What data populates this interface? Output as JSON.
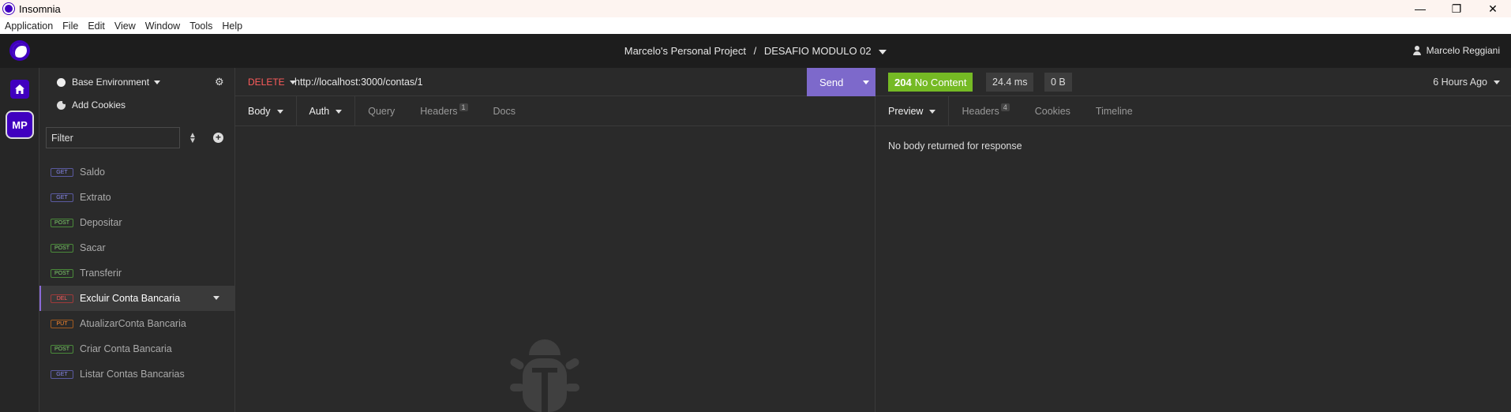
{
  "window": {
    "title": "Insomnia",
    "controls": [
      "minimize",
      "restore",
      "close"
    ]
  },
  "menu": [
    "Application",
    "File",
    "Edit",
    "View",
    "Window",
    "Tools",
    "Help"
  ],
  "header": {
    "project": "Marcelo's Personal Project",
    "separator": "/",
    "collection": "DESAFIO MODULO 02",
    "user": "Marcelo Reggiani"
  },
  "rail": {
    "workspace_badge": "MP"
  },
  "sidebar": {
    "environment": "Base Environment",
    "add_cookies": "Add Cookies",
    "filter_placeholder": "Filter",
    "requests": [
      {
        "method": "GET",
        "name": "Saldo"
      },
      {
        "method": "GET",
        "name": "Extrato"
      },
      {
        "method": "POST",
        "name": "Depositar"
      },
      {
        "method": "POST",
        "name": "Sacar"
      },
      {
        "method": "POST",
        "name": "Transferir"
      },
      {
        "method": "DEL",
        "name": "Excluir Conta Bancaria"
      },
      {
        "method": "PUT",
        "name": "AtualizarConta Bancaria"
      },
      {
        "method": "POST",
        "name": "Criar Conta Bancaria"
      },
      {
        "method": "GET",
        "name": "Listar Contas Bancarias"
      }
    ],
    "active_index": 5
  },
  "request": {
    "method": "DELETE",
    "url": "http://localhost:3000/contas/1",
    "send_label": "Send",
    "tabs": {
      "body": "Body",
      "auth": "Auth",
      "query": "Query",
      "headers": "Headers",
      "headers_count": "1",
      "docs": "Docs"
    }
  },
  "response": {
    "status_code": "204",
    "status_text": "No Content",
    "time": "24.4 ms",
    "size": "0 B",
    "ago": "6 Hours Ago",
    "tabs": {
      "preview": "Preview",
      "headers": "Headers",
      "headers_count": "4",
      "cookies": "Cookies",
      "timeline": "Timeline"
    },
    "body_message": "No body returned for response"
  },
  "colors": {
    "brand": "#4000bf",
    "send": "#7d69cb",
    "status_ok": "#75ba24",
    "delete": "#ff5c5c"
  }
}
